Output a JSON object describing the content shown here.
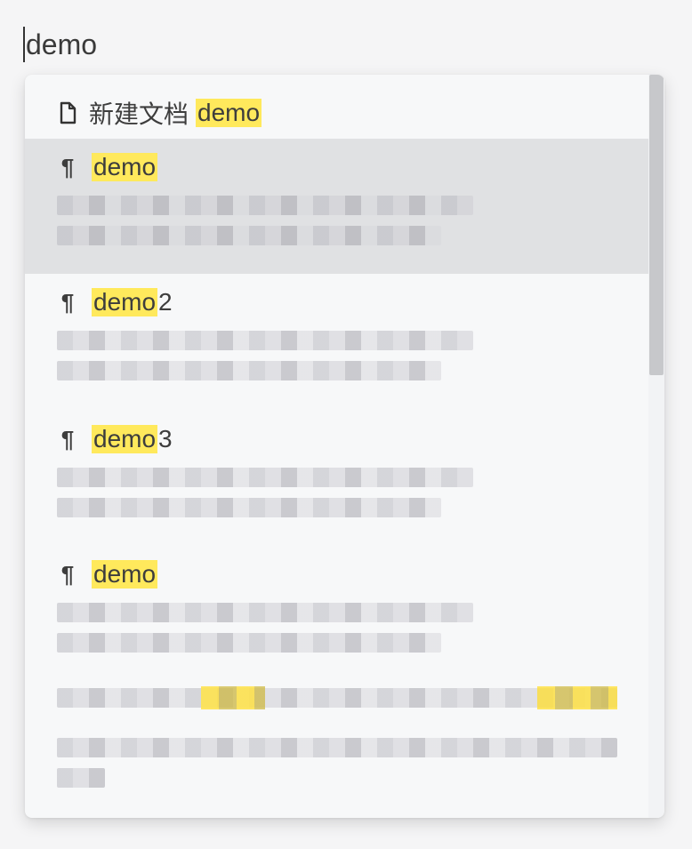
{
  "search": {
    "query": "demo"
  },
  "dropdown": {
    "new_doc": {
      "prefix": "新建文档",
      "keyword": "demo"
    },
    "results": [
      {
        "keyword": "demo",
        "suffix": ""
      },
      {
        "keyword": "demo",
        "suffix": "2"
      },
      {
        "keyword": "demo",
        "suffix": "3"
      },
      {
        "keyword": "demo",
        "suffix": ""
      }
    ]
  },
  "colors": {
    "highlight": "#ffe95c",
    "active_row": "#e0e1e3",
    "popup_bg": "#f7f8f9"
  },
  "icons": {
    "new_doc": "file-icon",
    "result": "pilcrow-icon"
  }
}
